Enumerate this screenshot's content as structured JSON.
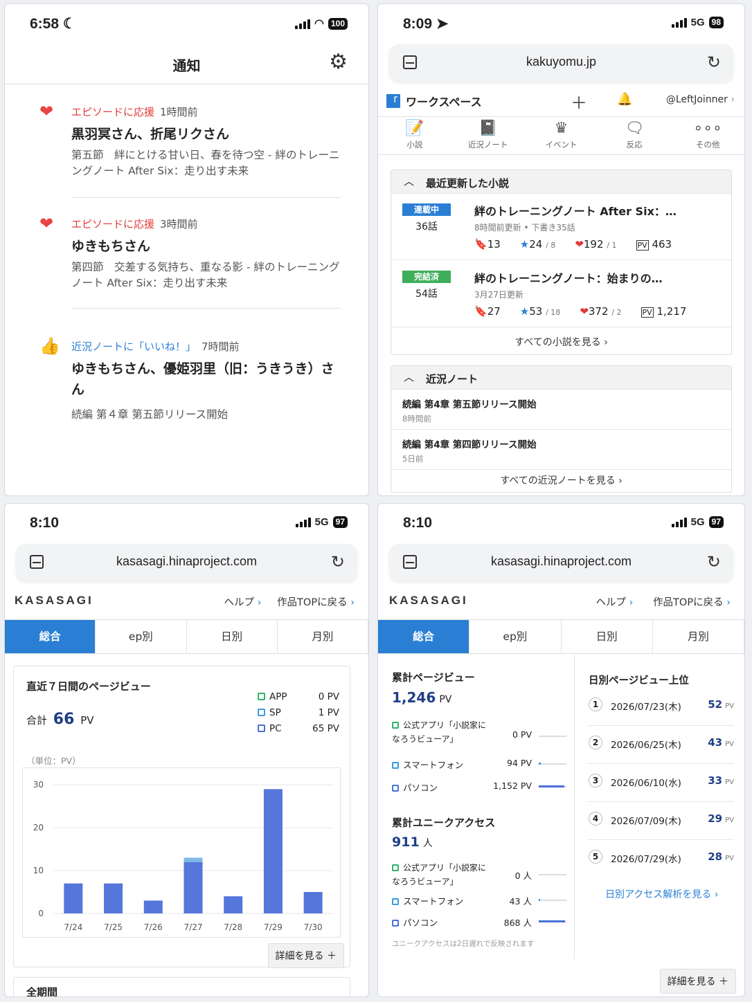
{
  "p1": {
    "status": {
      "time": "6:58",
      "battery": "100"
    },
    "title": "通知",
    "notifications": [
      {
        "kind": "エピソードに応援",
        "ago": "1時間前",
        "who": "黒羽冥さん、折尾リクさん",
        "body": "第五節　絆にとける甘い日、春を待つ空 - 絆のトレーニングノート After Six：走り出す未来"
      },
      {
        "kind": "エピソードに応援",
        "ago": "3時間前",
        "who": "ゆきもちさん",
        "body": "第四節　交差する気持ち、重なる影 - 絆のトレーニングノート After Six：走り出す未来"
      },
      {
        "kind": "近況ノートに「いいね！」",
        "ago": "7時間前",
        "who": "ゆきもちさん、優姫羽里（旧：うきうき）さん",
        "body": "続編 第４章 第五節リリース開始"
      }
    ]
  },
  "p2": {
    "status": {
      "time": "8:09",
      "net": "5G",
      "battery": "98"
    },
    "url": "kakuyomu.jp",
    "workspace": "ワークスペース",
    "user": "@LeftJoinner",
    "nav": [
      "小説",
      "近況ノート",
      "イベント",
      "反応",
      "その他"
    ],
    "recent_title": "最近更新した小説",
    "novels": [
      {
        "badge": "連載中",
        "badge_color": "#2a7fd4",
        "episodes": "36話",
        "title": "絆のトレーニングノート After Six：…",
        "meta": "8時間前更新 • 下書き35話",
        "bookmarks": "13",
        "stars": "24",
        "stars_sub": "/ 8",
        "hearts": "192",
        "hearts_sub": "/ 1",
        "pv": "463"
      },
      {
        "badge": "完結済",
        "badge_color": "#3fae5a",
        "episodes": "54話",
        "title": "絆のトレーニングノート：始まりの…",
        "meta": "3月27日更新",
        "bookmarks": "27",
        "stars": "53",
        "stars_sub": "/ 18",
        "hearts": "372",
        "hearts_sub": "/ 2",
        "pv": "1,217"
      }
    ],
    "see_all_novels": "すべての小説を見る",
    "notes_title": "近況ノート",
    "notes": [
      {
        "title": "続編 第4章 第五節リリース開始",
        "date": "8時間前"
      },
      {
        "title": "続編 第4章 第四節リリース開始",
        "date": "5日前"
      }
    ],
    "see_all_notes": "すべての近況ノートを見る"
  },
  "p3": {
    "status": {
      "time": "8:10",
      "net": "5G",
      "battery": "97"
    },
    "url": "kasasagi.hinaproject.com",
    "brand": "KASASAGI",
    "help": "ヘルプ",
    "back": "作品TOPに戻る",
    "tabs": [
      "総合",
      "ep別",
      "日別",
      "月別"
    ],
    "card_title": "直近７日間のページビュー",
    "total_label": "合計",
    "total": "66",
    "unit": "PV",
    "legend": [
      {
        "name": "APP",
        "value": "0 PV",
        "color": "#2fb36b"
      },
      {
        "name": "SP",
        "value": "1 PV",
        "color": "#3a9be0"
      },
      {
        "name": "PC",
        "value": "65 PV",
        "color": "#4a6fd8"
      }
    ],
    "unit_note": "（単位：PV）",
    "detail": "詳細を見る",
    "all_period": "全期間"
  },
  "chart_data": {
    "type": "bar",
    "categories": [
      "7/24",
      "7/25",
      "7/26",
      "7/27",
      "7/28",
      "7/29",
      "7/30"
    ],
    "series": [
      {
        "name": "PC",
        "values": [
          7,
          7,
          3,
          12,
          4,
          29,
          5
        ]
      },
      {
        "name": "SP",
        "values": [
          0,
          0,
          0,
          1,
          0,
          0,
          0
        ]
      }
    ],
    "yticks": [
      0,
      10,
      20,
      30
    ],
    "ylim": [
      0,
      31
    ],
    "colors": {
      "PC": "#5576da",
      "SP": "#7fb9e8"
    }
  },
  "p4": {
    "status": {
      "time": "8:10",
      "net": "5G",
      "battery": "97"
    },
    "url": "kasasagi.hinaproject.com",
    "brand": "KASASAGI",
    "help": "ヘルプ",
    "back": "作品TOPに戻る",
    "tabs": [
      "総合",
      "ep別",
      "日別",
      "月別"
    ],
    "pv_title": "累計ページビュー",
    "pv_total": "1,246",
    "pv_unit": "PV",
    "pv_rows": [
      {
        "name": "公式アプリ「小説家になろうビューア」",
        "value": "0 PV",
        "ratio": 0,
        "color": "#2fb36b"
      },
      {
        "name": "スマートフォン",
        "value": "94 PV",
        "ratio": 0.08,
        "color": "#3a9be0"
      },
      {
        "name": "パソコン",
        "value": "1,152 PV",
        "ratio": 0.92,
        "color": "#4a6fd8"
      }
    ],
    "ua_title": "累計ユニークアクセス",
    "ua_total": "911",
    "ua_unit": "人",
    "ua_rows": [
      {
        "name": "公式アプリ「小説家になろうビューア」",
        "value": "0 人",
        "ratio": 0,
        "color": "#2fb36b"
      },
      {
        "name": "スマートフォン",
        "value": "43 人",
        "ratio": 0.05,
        "color": "#3a9be0"
      },
      {
        "name": "パソコン",
        "value": "868 人",
        "ratio": 0.95,
        "color": "#4a6fd8"
      }
    ],
    "ua_note": "ユニークアクセスは2日遅れで反映されます",
    "top_title": "日別ページビュー上位",
    "top": [
      {
        "rank": "1",
        "date": "2026/07/23(木)",
        "pv": "52"
      },
      {
        "rank": "2",
        "date": "2026/06/25(木)",
        "pv": "43"
      },
      {
        "rank": "3",
        "date": "2026/06/10(水)",
        "pv": "33"
      },
      {
        "rank": "4",
        "date": "2026/07/09(木)",
        "pv": "29"
      },
      {
        "rank": "5",
        "date": "2026/07/29(水)",
        "pv": "28"
      }
    ],
    "pv_small": "PV",
    "daily_link": "日別アクセス解析を見る",
    "detail": "詳細を見る"
  }
}
